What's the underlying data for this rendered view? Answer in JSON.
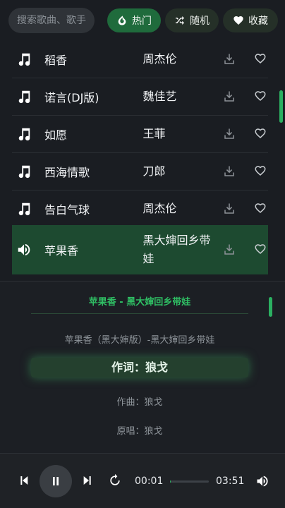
{
  "search": {
    "placeholder": "搜索歌曲、歌手..."
  },
  "filters": {
    "hot": "热门",
    "random": "随机",
    "favorites": "收藏"
  },
  "songs": [
    {
      "title": "稻香",
      "artist": "周杰伦"
    },
    {
      "title": "诺言(DJ版)",
      "artist": "魏佳艺"
    },
    {
      "title": "如愿",
      "artist": "王菲"
    },
    {
      "title": "西海情歌",
      "artist": "刀郎"
    },
    {
      "title": "告白气球",
      "artist": "周杰伦"
    },
    {
      "title": "苹果香",
      "artist": "黑大婶回乡带娃",
      "playing": true
    }
  ],
  "lyrics": {
    "header": "苹果香 - 黑大婶回乡带娃",
    "lines": [
      "苹果香（黑大婶版）-黑大婶回乡带娃",
      "作词：狼戈",
      "作曲：狼戈",
      "原唱：狼戈"
    ]
  },
  "player": {
    "elapsed": "00:01",
    "duration": "03:51",
    "progress": 0.005
  },
  "colors": {
    "accent": "#2bb061",
    "active_row": "#1d4a30",
    "background": "#1a1d22"
  }
}
